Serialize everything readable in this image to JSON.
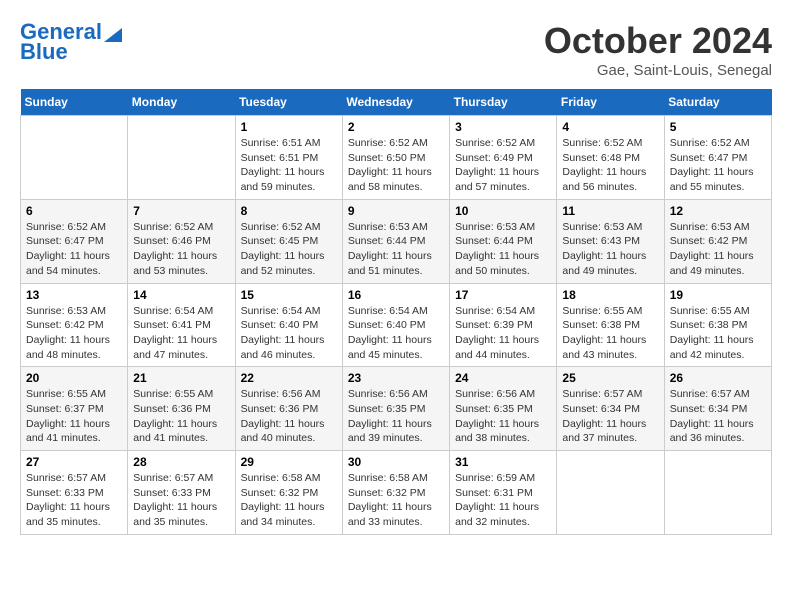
{
  "header": {
    "logo_line1": "General",
    "logo_line2": "Blue",
    "title": "October 2024",
    "location": "Gae, Saint-Louis, Senegal"
  },
  "columns": [
    "Sunday",
    "Monday",
    "Tuesday",
    "Wednesday",
    "Thursday",
    "Friday",
    "Saturday"
  ],
  "weeks": [
    [
      {
        "day": "",
        "info": ""
      },
      {
        "day": "",
        "info": ""
      },
      {
        "day": "1",
        "info": "Sunrise: 6:51 AM\nSunset: 6:51 PM\nDaylight: 11 hours and 59 minutes."
      },
      {
        "day": "2",
        "info": "Sunrise: 6:52 AM\nSunset: 6:50 PM\nDaylight: 11 hours and 58 minutes."
      },
      {
        "day": "3",
        "info": "Sunrise: 6:52 AM\nSunset: 6:49 PM\nDaylight: 11 hours and 57 minutes."
      },
      {
        "day": "4",
        "info": "Sunrise: 6:52 AM\nSunset: 6:48 PM\nDaylight: 11 hours and 56 minutes."
      },
      {
        "day": "5",
        "info": "Sunrise: 6:52 AM\nSunset: 6:47 PM\nDaylight: 11 hours and 55 minutes."
      }
    ],
    [
      {
        "day": "6",
        "info": "Sunrise: 6:52 AM\nSunset: 6:47 PM\nDaylight: 11 hours and 54 minutes."
      },
      {
        "day": "7",
        "info": "Sunrise: 6:52 AM\nSunset: 6:46 PM\nDaylight: 11 hours and 53 minutes."
      },
      {
        "day": "8",
        "info": "Sunrise: 6:52 AM\nSunset: 6:45 PM\nDaylight: 11 hours and 52 minutes."
      },
      {
        "day": "9",
        "info": "Sunrise: 6:53 AM\nSunset: 6:44 PM\nDaylight: 11 hours and 51 minutes."
      },
      {
        "day": "10",
        "info": "Sunrise: 6:53 AM\nSunset: 6:44 PM\nDaylight: 11 hours and 50 minutes."
      },
      {
        "day": "11",
        "info": "Sunrise: 6:53 AM\nSunset: 6:43 PM\nDaylight: 11 hours and 49 minutes."
      },
      {
        "day": "12",
        "info": "Sunrise: 6:53 AM\nSunset: 6:42 PM\nDaylight: 11 hours and 49 minutes."
      }
    ],
    [
      {
        "day": "13",
        "info": "Sunrise: 6:53 AM\nSunset: 6:42 PM\nDaylight: 11 hours and 48 minutes."
      },
      {
        "day": "14",
        "info": "Sunrise: 6:54 AM\nSunset: 6:41 PM\nDaylight: 11 hours and 47 minutes."
      },
      {
        "day": "15",
        "info": "Sunrise: 6:54 AM\nSunset: 6:40 PM\nDaylight: 11 hours and 46 minutes."
      },
      {
        "day": "16",
        "info": "Sunrise: 6:54 AM\nSunset: 6:40 PM\nDaylight: 11 hours and 45 minutes."
      },
      {
        "day": "17",
        "info": "Sunrise: 6:54 AM\nSunset: 6:39 PM\nDaylight: 11 hours and 44 minutes."
      },
      {
        "day": "18",
        "info": "Sunrise: 6:55 AM\nSunset: 6:38 PM\nDaylight: 11 hours and 43 minutes."
      },
      {
        "day": "19",
        "info": "Sunrise: 6:55 AM\nSunset: 6:38 PM\nDaylight: 11 hours and 42 minutes."
      }
    ],
    [
      {
        "day": "20",
        "info": "Sunrise: 6:55 AM\nSunset: 6:37 PM\nDaylight: 11 hours and 41 minutes."
      },
      {
        "day": "21",
        "info": "Sunrise: 6:55 AM\nSunset: 6:36 PM\nDaylight: 11 hours and 41 minutes."
      },
      {
        "day": "22",
        "info": "Sunrise: 6:56 AM\nSunset: 6:36 PM\nDaylight: 11 hours and 40 minutes."
      },
      {
        "day": "23",
        "info": "Sunrise: 6:56 AM\nSunset: 6:35 PM\nDaylight: 11 hours and 39 minutes."
      },
      {
        "day": "24",
        "info": "Sunrise: 6:56 AM\nSunset: 6:35 PM\nDaylight: 11 hours and 38 minutes."
      },
      {
        "day": "25",
        "info": "Sunrise: 6:57 AM\nSunset: 6:34 PM\nDaylight: 11 hours and 37 minutes."
      },
      {
        "day": "26",
        "info": "Sunrise: 6:57 AM\nSunset: 6:34 PM\nDaylight: 11 hours and 36 minutes."
      }
    ],
    [
      {
        "day": "27",
        "info": "Sunrise: 6:57 AM\nSunset: 6:33 PM\nDaylight: 11 hours and 35 minutes."
      },
      {
        "day": "28",
        "info": "Sunrise: 6:57 AM\nSunset: 6:33 PM\nDaylight: 11 hours and 35 minutes."
      },
      {
        "day": "29",
        "info": "Sunrise: 6:58 AM\nSunset: 6:32 PM\nDaylight: 11 hours and 34 minutes."
      },
      {
        "day": "30",
        "info": "Sunrise: 6:58 AM\nSunset: 6:32 PM\nDaylight: 11 hours and 33 minutes."
      },
      {
        "day": "31",
        "info": "Sunrise: 6:59 AM\nSunset: 6:31 PM\nDaylight: 11 hours and 32 minutes."
      },
      {
        "day": "",
        "info": ""
      },
      {
        "day": "",
        "info": ""
      }
    ]
  ]
}
